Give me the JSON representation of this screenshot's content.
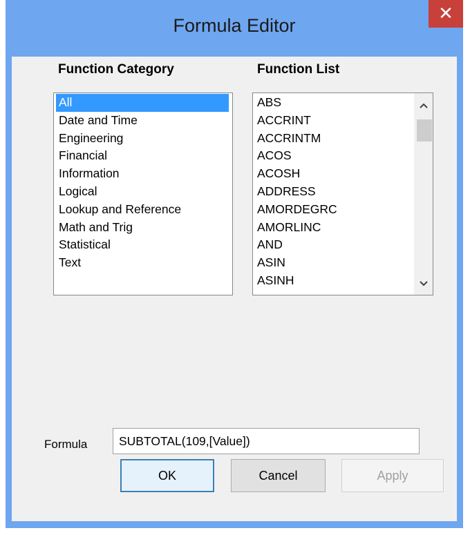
{
  "window": {
    "title": "Formula Editor",
    "close_glyph": "✕"
  },
  "category": {
    "heading": "Function Category",
    "items": [
      "All",
      "Date and Time",
      "Engineering",
      "Financial",
      "Information",
      "Logical",
      "Lookup and Reference",
      "Math and Trig",
      "Statistical",
      "Text"
    ],
    "selected": "All"
  },
  "functions": {
    "heading": "Function List",
    "items": [
      "ABS",
      "ACCRINT",
      "ACCRINTM",
      "ACOS",
      "ACOSH",
      "ADDRESS",
      "AMORDEGRC",
      "AMORLINC",
      "AND",
      "ASIN",
      "ASINH"
    ],
    "scroll_up_icon": "chevron-up-icon",
    "scroll_down_icon": "chevron-down-icon"
  },
  "formula": {
    "label": "Formula",
    "value": "SUBTOTAL(109,[Value])"
  },
  "buttons": {
    "ok": "OK",
    "cancel": "Cancel",
    "apply": "Apply"
  },
  "colors": {
    "title_bar": "#6ea6f0",
    "close_button": "#c7403a",
    "selection": "#3399ff"
  }
}
